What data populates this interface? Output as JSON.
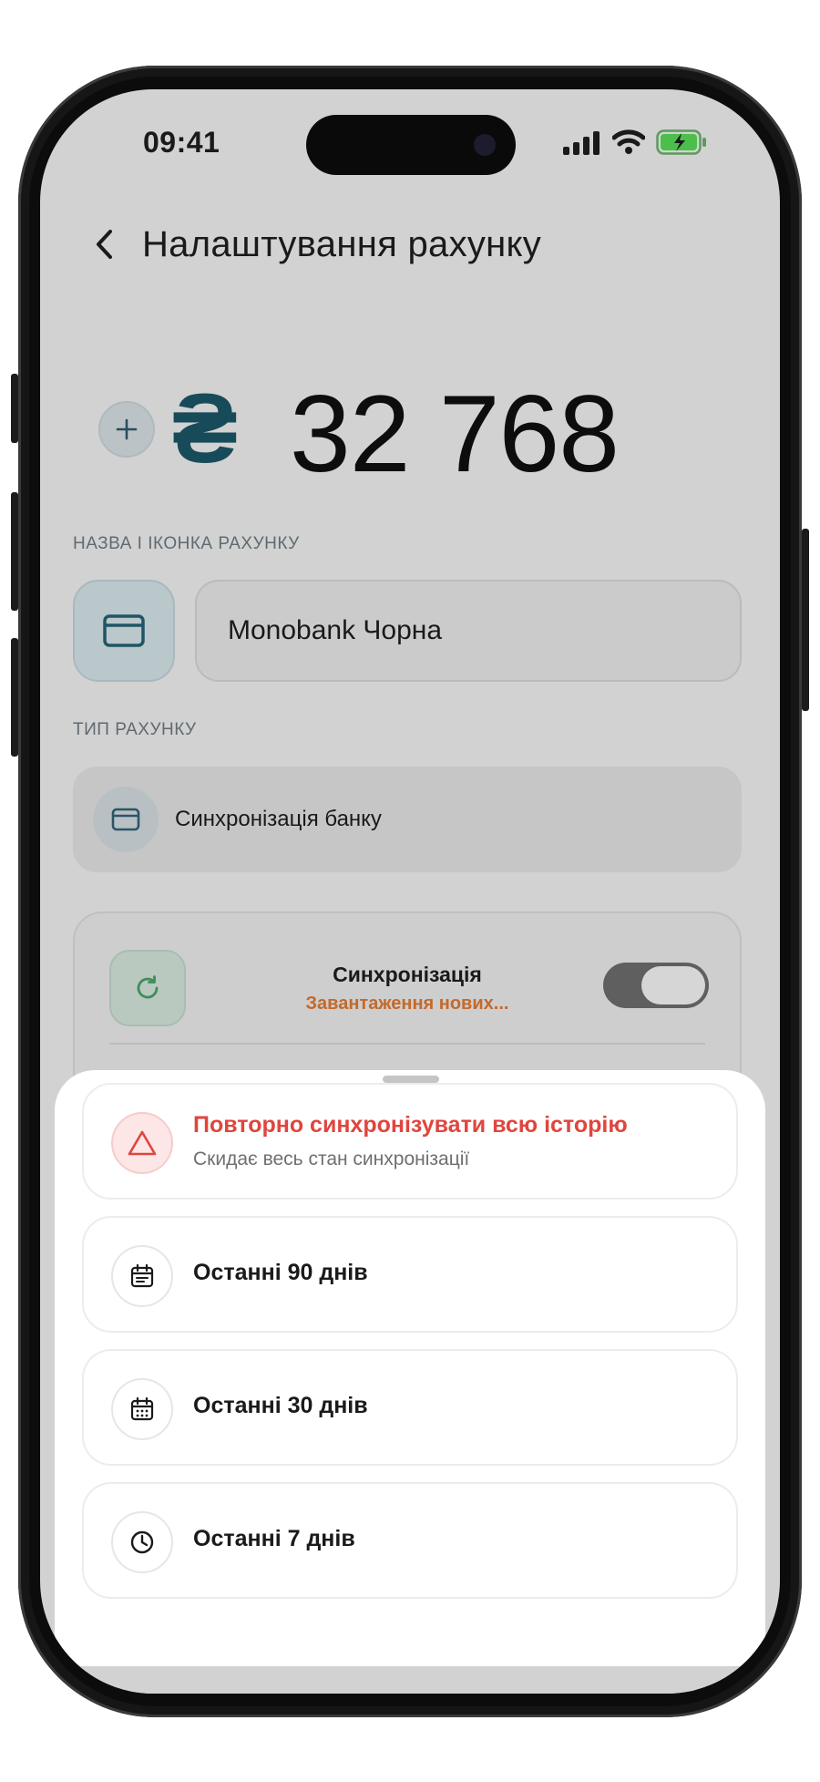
{
  "status_bar": {
    "time": "09:41"
  },
  "header": {
    "title": "Налаштування рахунку"
  },
  "balance": {
    "currency_symbol": "₴",
    "amount": "32 768"
  },
  "account_name": {
    "section_label": "НАЗВА І ІКОНКА РАХУНКУ",
    "value": "Monobank Чорна"
  },
  "account_type": {
    "section_label": "ТИП РАХУНКУ",
    "label": "Синхронізація банку"
  },
  "sync": {
    "title": "Синхронізація",
    "status": "Завантаження нових...",
    "enabled": true
  },
  "sheet": {
    "options": [
      {
        "title": "Повторно синхронізувати всю історію",
        "subtitle": "Скидає весь стан синхронізації",
        "icon": "warning-icon",
        "danger": true
      },
      {
        "title": "Останні 90 днів",
        "icon": "calendar-list-icon"
      },
      {
        "title": "Останні 30 днів",
        "icon": "calendar-grid-icon"
      },
      {
        "title": "Останні 7 днів",
        "icon": "clock-icon"
      }
    ]
  },
  "colors": {
    "accent": "#174b5a",
    "danger": "#e0453e",
    "sync_status": "#c4692a"
  }
}
